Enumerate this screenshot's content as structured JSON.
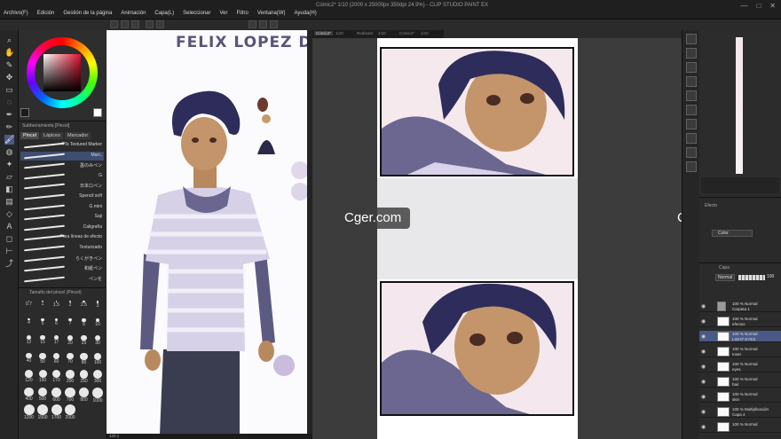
{
  "window": {
    "title": "Cómic2* 1/10 (2000 x 25000px 350dpi 24.9%) - CLIP STUDIO PAINT EX",
    "controls": [
      "—",
      "□",
      "✕"
    ]
  },
  "menu": [
    "Archivo(F)",
    "Edición",
    "Gestión de la página",
    "Animación",
    "Capa(L)",
    "Seleccionar",
    "Ver",
    "Filtro",
    "Ventana(W)",
    "Ayuda(H)"
  ],
  "tool_icons": [
    "magnifier-icon",
    "hand-icon",
    "eyedropper-icon",
    "move-icon",
    "select-icon",
    "lasso-icon",
    "pen-icon",
    "pencil-icon",
    "brush-icon",
    "airbrush-icon",
    "decoration-icon",
    "eraser-icon",
    "fill-icon",
    "gradient-icon",
    "figure-icon",
    "text-icon",
    "balloon-icon",
    "ruler-icon",
    "correct-line-icon"
  ],
  "brush_panel": {
    "title": "Subherramienta [Pincel]",
    "tabs": [
      "Pincel",
      "Lápices",
      "Marcador"
    ],
    "brushes": [
      "TTs Textured Marker",
      "Marc.",
      "墨のみペン",
      "G",
      "日本ロぺン",
      "Spencil soft",
      "G mini",
      "Saji",
      "Caligrafía",
      "Para líneas de efecto",
      "Texturizado",
      "らくがきペン",
      "和紙ペン",
      "ペンを"
    ]
  },
  "size_panel": {
    "title": "Tamaño del pincel (Pincel)",
    "sizes": [
      "0.7",
      "1",
      "1.5",
      "2",
      "2.5",
      "3",
      "4",
      "5",
      "6",
      "7",
      "8",
      "10",
      "12",
      "15",
      "17",
      "20",
      "25",
      "30",
      "40",
      "50",
      "60",
      "70",
      "80",
      "100",
      "120",
      "150",
      "170",
      "200",
      "250",
      "300",
      "400",
      "500",
      "600",
      "700",
      "800",
      "1000",
      "1200",
      "1500",
      "1700",
      "2000"
    ]
  },
  "canvas": {
    "page1_title": "FELIX LOPEZ D",
    "tabs": [
      "Cómic2*",
      "1/10",
      "Redactar",
      "1/10",
      "Cómic2*",
      "1/10"
    ]
  },
  "watermark": "Cger.com",
  "effect_panel": {
    "title": "Efecto",
    "mode": "Color"
  },
  "layer_panel": {
    "title": "Capa",
    "blend_mode": "Normal",
    "opacity": "100",
    "layers": [
      {
        "line1": "100 % Normal",
        "line2": "Carpeta 1",
        "folder": true,
        "selected": false
      },
      {
        "line1": "100 % Normal",
        "line2": "efectos",
        "folder": false,
        "selected": false
      },
      {
        "line1": "100 % Normal",
        "line2": "LIGHT EYES",
        "folder": false,
        "selected": true
      },
      {
        "line1": "100 % Normal",
        "line2": "Inset",
        "folder": false,
        "selected": false
      },
      {
        "line1": "100 % Normal",
        "line2": "eyes",
        "folder": false,
        "selected": false
      },
      {
        "line1": "100 % Normal",
        "line2": "hair",
        "folder": false,
        "selected": false
      },
      {
        "line1": "100 % Normal",
        "line2": "skin",
        "folder": false,
        "selected": false
      },
      {
        "line1": "100 % Multiplicación",
        "line2": "Capa 4",
        "folder": false,
        "selected": false
      },
      {
        "line1": "100 % Normal",
        "line2": "",
        "folder": false,
        "selected": false
      }
    ]
  },
  "status": {
    "zoom_left": "120.1",
    "zoom_right": "24.9"
  }
}
